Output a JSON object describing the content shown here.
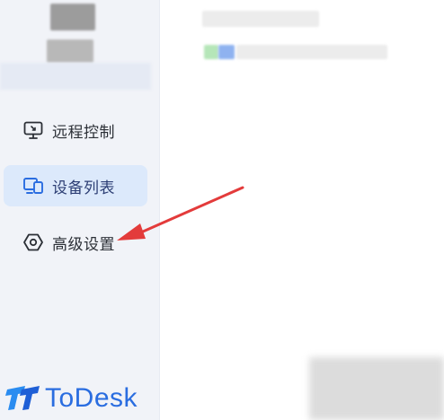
{
  "sidebar": {
    "items": [
      {
        "label": "远程控制",
        "icon": "remote-control-icon",
        "active": false
      },
      {
        "label": "设备列表",
        "icon": "device-list-icon",
        "active": true
      },
      {
        "label": "高级设置",
        "icon": "advanced-settings-icon",
        "active": false
      }
    ]
  },
  "logo": {
    "text": "ToDesk"
  },
  "colors": {
    "accent": "#2a6de0",
    "sidebar_bg": "#f1f3f8",
    "active_bg": "#dce9fb",
    "annotation_arrow": "#e33b3b"
  }
}
